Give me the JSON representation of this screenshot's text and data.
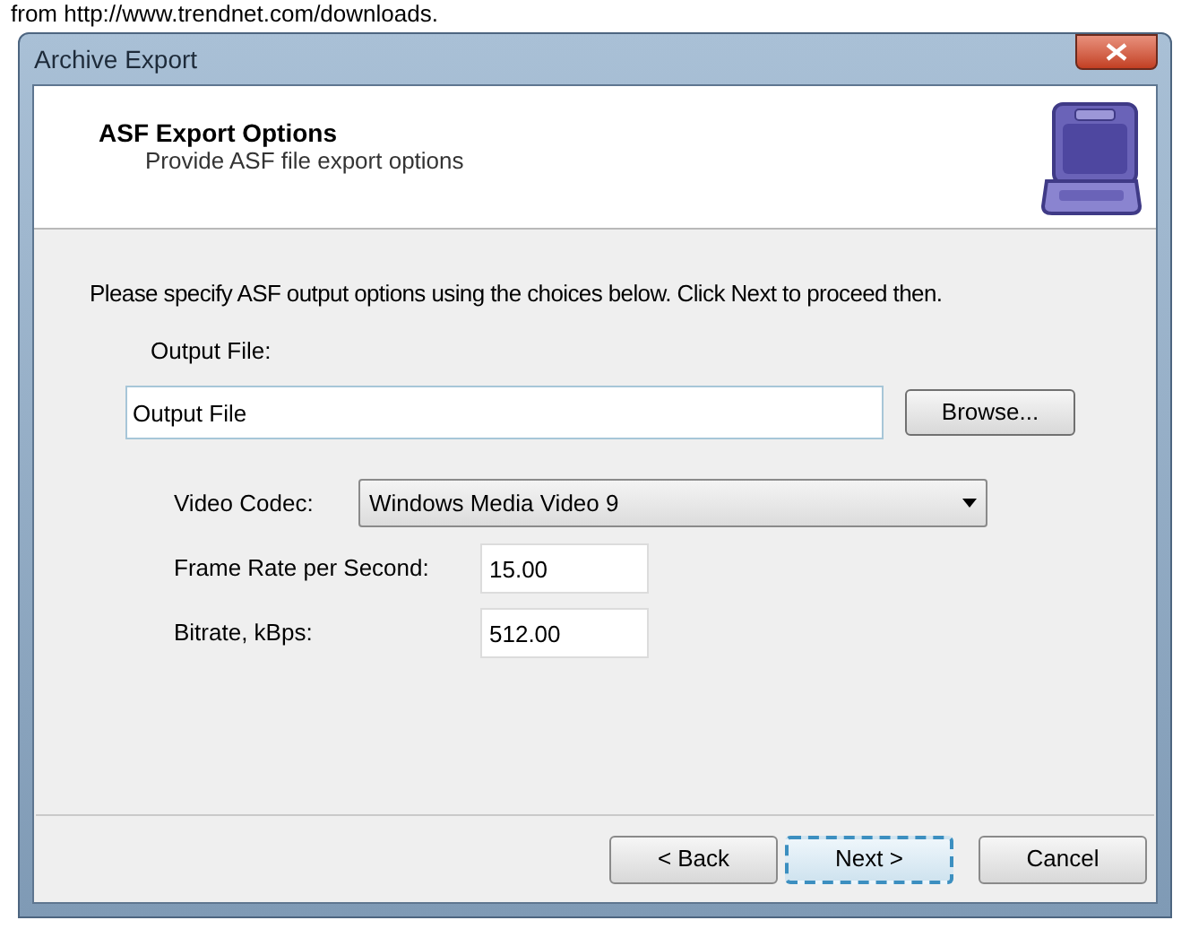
{
  "caption_above": "from http://www.trendnet.com/downloads.",
  "window": {
    "title": "Archive Export"
  },
  "header": {
    "title": "ASF Export Options",
    "subtitle": "Provide ASF file export options"
  },
  "instructions": "Please specify ASF output options using the choices below. Click Next to proceed then.",
  "output_file": {
    "label": "Output File:",
    "value": "Output File",
    "browse": "Browse..."
  },
  "video_codec": {
    "label": "Video Codec:",
    "value": "Windows Media Video 9"
  },
  "frame_rate": {
    "label": "Frame Rate per Second:",
    "value": "15.00"
  },
  "bitrate": {
    "label": "Bitrate, kBps:",
    "value": "512.00"
  },
  "buttons": [
    {
      "label": "< Back",
      "focused": false
    },
    {
      "label": "Next >",
      "focused": true
    },
    {
      "label": "Cancel",
      "focused": false
    }
  ]
}
